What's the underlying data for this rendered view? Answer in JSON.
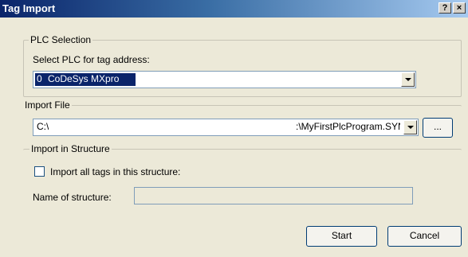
{
  "window": {
    "title": "Tag Import",
    "help_label": "?",
    "close_label": "×"
  },
  "plc_selection": {
    "group_label": "PLC Selection",
    "prompt": "Select PLC for tag address:",
    "plc_index": "0",
    "plc_name": "CoDeSys MXpro"
  },
  "import_file": {
    "group_label": "Import File",
    "path_start": "C:\\",
    "path_end": ":\\MyFirstPlcProgram.SYN",
    "browse_label": "..."
  },
  "import_structure": {
    "group_label": "Import in Structure",
    "checkbox_label": "Import all tags in this structure:",
    "checkbox_checked": false,
    "name_label": "Name of structure:",
    "name_value": ""
  },
  "buttons": {
    "start_label": "Start",
    "cancel_label": "Cancel"
  }
}
